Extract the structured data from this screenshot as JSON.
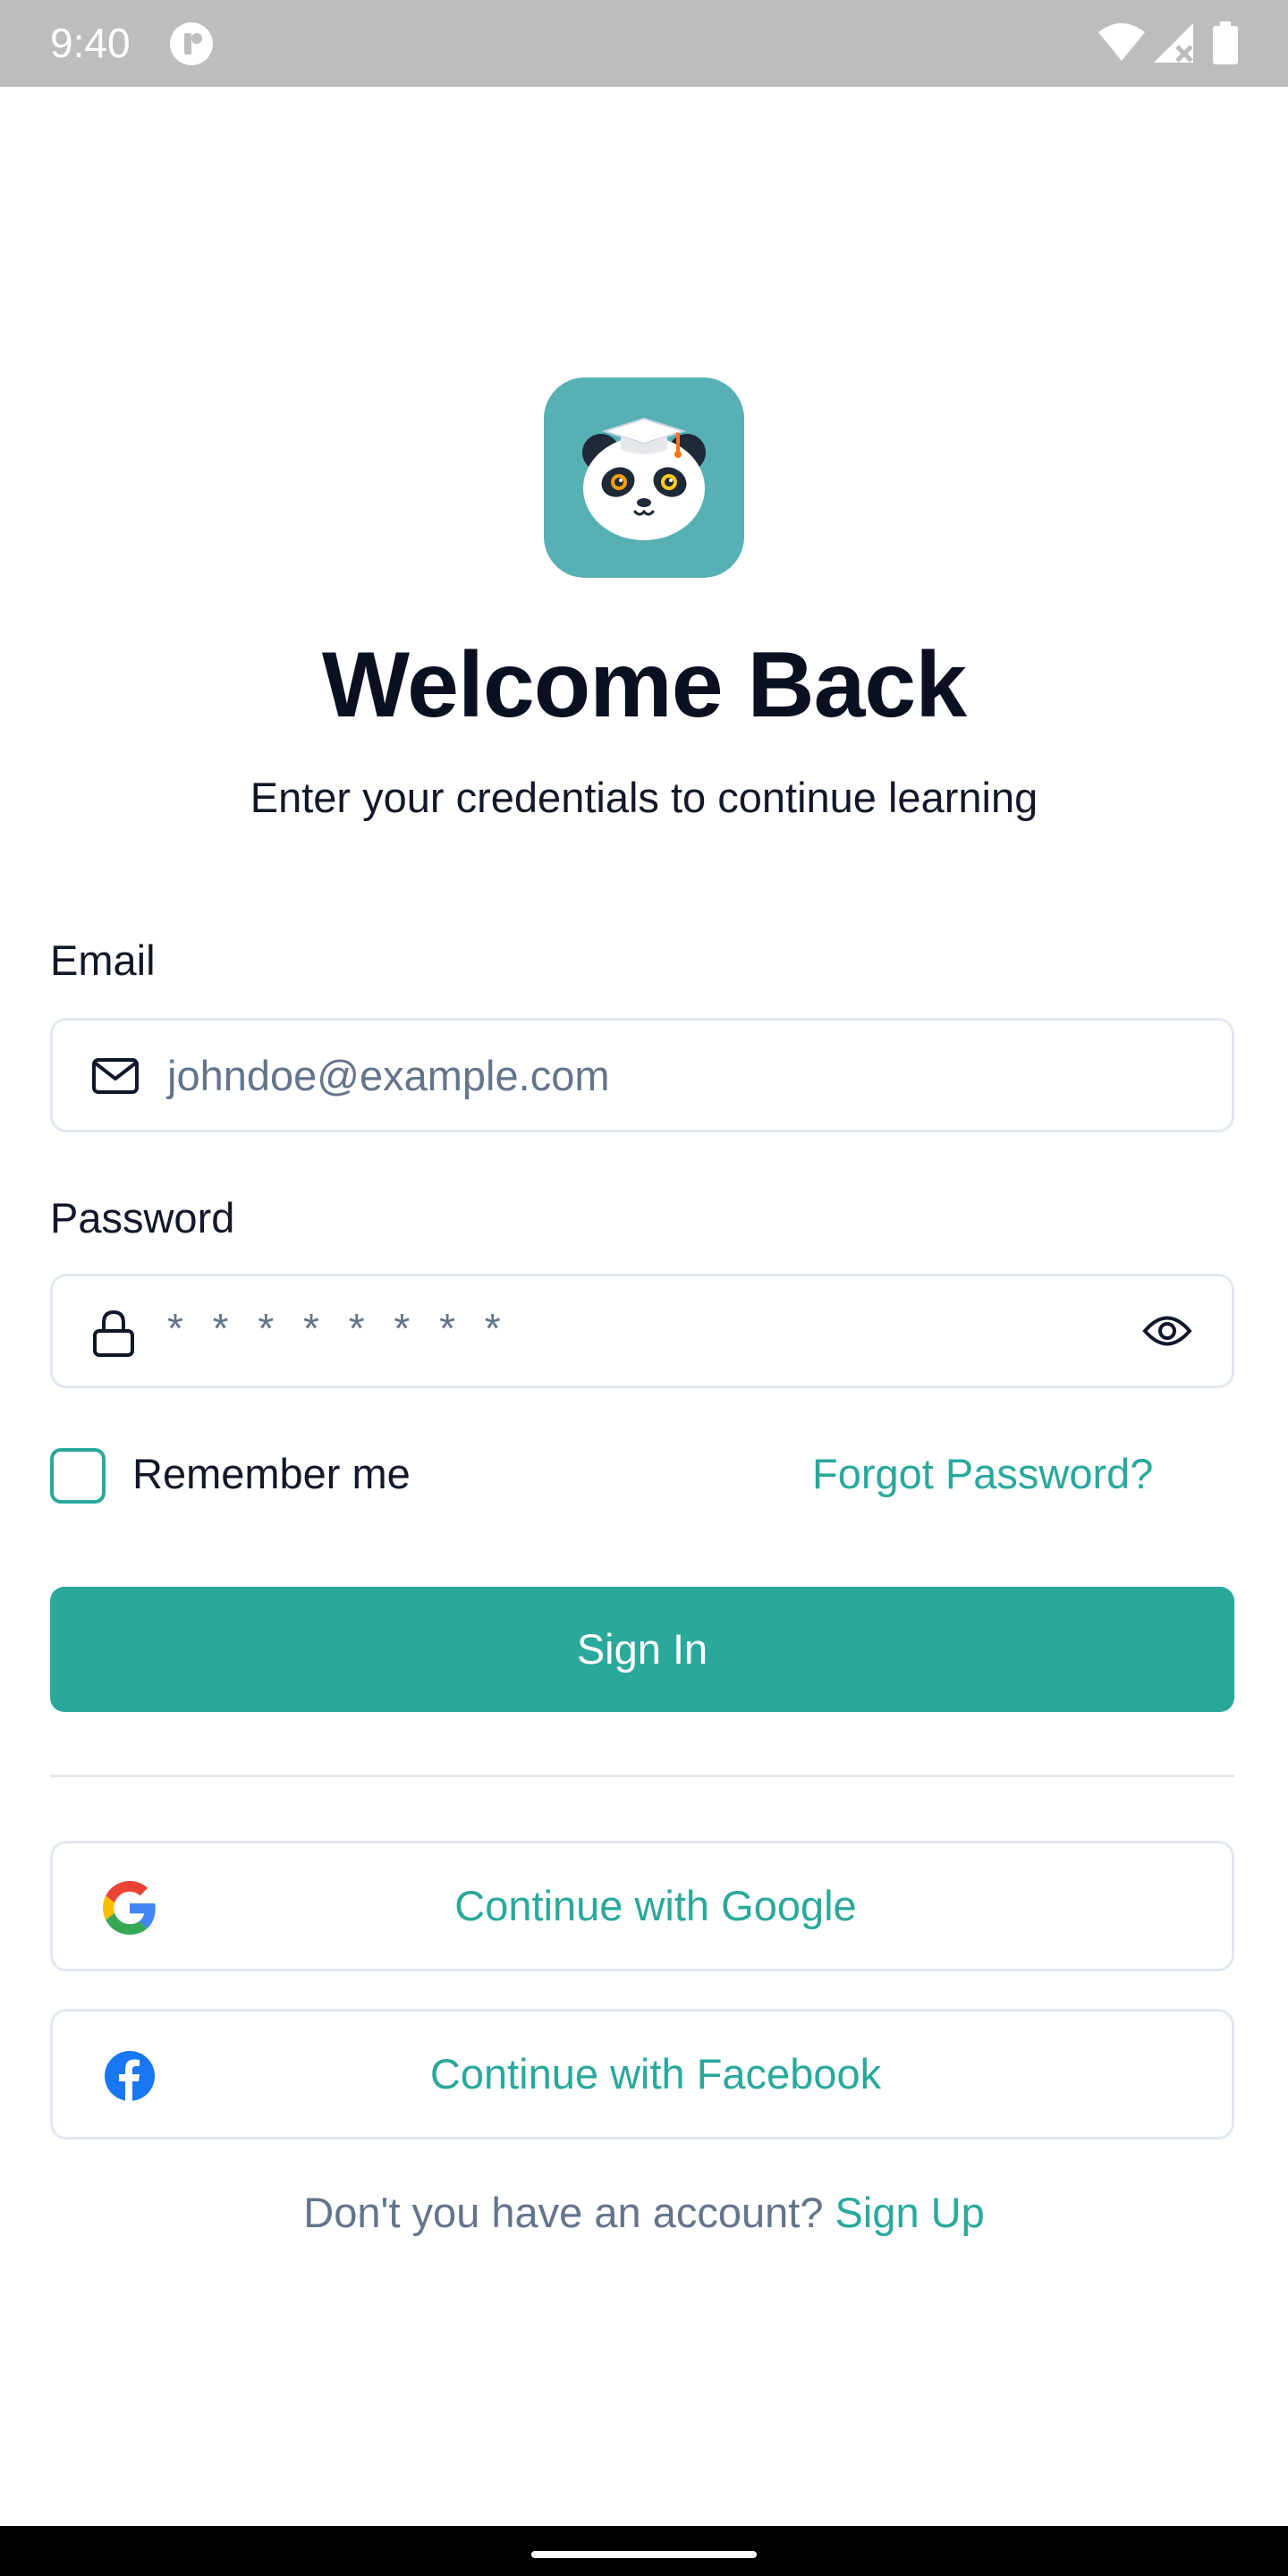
{
  "status_bar": {
    "time": "9:40",
    "icons": [
      "app-notification-icon",
      "wifi-icon",
      "cellular-signal-icon",
      "battery-icon"
    ]
  },
  "logo": {
    "icon": "panda-graduation-cap-logo",
    "background_color": "#57b0b4"
  },
  "header": {
    "title": "Welcome Back",
    "subtitle": "Enter your credentials to continue learning"
  },
  "form": {
    "email": {
      "label": "Email",
      "placeholder": "johndoe@example.com",
      "icon": "mail-icon"
    },
    "password": {
      "label": "Password",
      "placeholder": "* * * * * * * *",
      "icon": "lock-icon",
      "toggle_icon": "eye-icon"
    },
    "remember_me": {
      "label": "Remember me",
      "checked": false
    },
    "forgot_password": "Forgot Password?",
    "sign_in": "Sign In"
  },
  "social": {
    "google": {
      "label": "Continue with Google",
      "icon": "google-icon"
    },
    "facebook": {
      "label": "Continue with Facebook",
      "icon": "facebook-icon"
    }
  },
  "footer": {
    "prompt": "Don't you have an account?",
    "link": "Sign Up"
  },
  "colors": {
    "accent": "#2aa89c",
    "text_dark": "#0b1020",
    "text_muted": "#64748b",
    "border": "#e2e8f0",
    "facebook_blue": "#1877f2"
  }
}
